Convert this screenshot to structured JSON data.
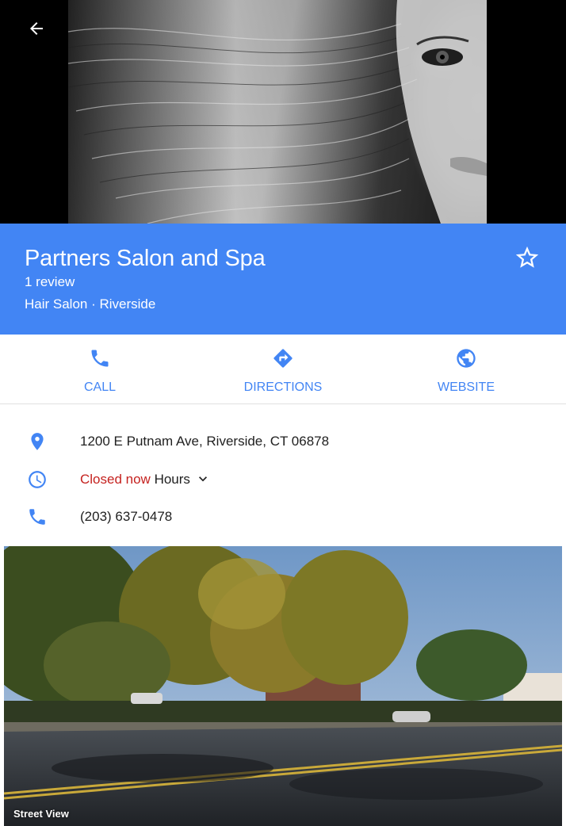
{
  "hero": {
    "photo_desc_icon": "portrait-photo"
  },
  "header": {
    "name": "Partners Salon and Spa",
    "reviews": "1 review",
    "category": "Hair Salon · Riverside",
    "color": "#4285f4"
  },
  "actions": [
    {
      "label": "CALL",
      "icon": "phone-icon"
    },
    {
      "label": "DIRECTIONS",
      "icon": "directions-icon"
    },
    {
      "label": "WEBSITE",
      "icon": "globe-icon"
    }
  ],
  "info": {
    "address": "1200 E Putnam Ave, Riverside, CT 06878",
    "status": "Closed now",
    "hours_label": "Hours",
    "phone": "(203) 637-0478"
  },
  "street_view": {
    "label": "Street View"
  },
  "colors": {
    "accent": "#4285f4",
    "closed": "#c5221f",
    "text": "#212121"
  }
}
